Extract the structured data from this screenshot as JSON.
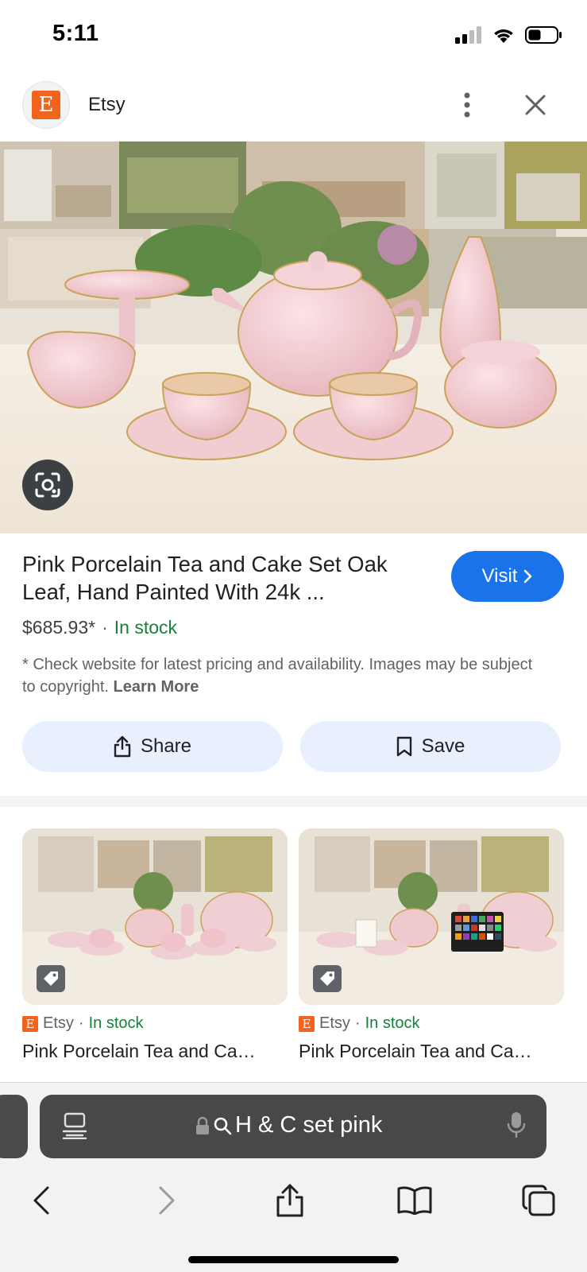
{
  "status_bar": {
    "time": "5:11"
  },
  "site": {
    "logo_letter": "E",
    "name": "Etsy"
  },
  "product": {
    "title": "Pink Porcelain Tea and Cake Set Oak Leaf, Hand Painted With 24k ...",
    "price": "$685.93*",
    "separator": "·",
    "stock": "In stock",
    "disclaimer": "* Check website for latest pricing and availability. Images may be subject to copyright.",
    "learn_more": "Learn More"
  },
  "buttons": {
    "visit": "Visit",
    "share": "Share",
    "save": "Save"
  },
  "related": [
    {
      "source": "Etsy",
      "dot": "·",
      "stock": "In stock",
      "title": "Pink Porcelain Tea and Ca…"
    },
    {
      "source": "Etsy",
      "dot": "·",
      "stock": "In stock",
      "title": "Pink Porcelain Tea and Ca…"
    }
  ],
  "browser": {
    "address": "H & C set pink"
  },
  "colors": {
    "accent": "#1a73e8",
    "stock": "#188038",
    "etsy": "#f1641e"
  }
}
